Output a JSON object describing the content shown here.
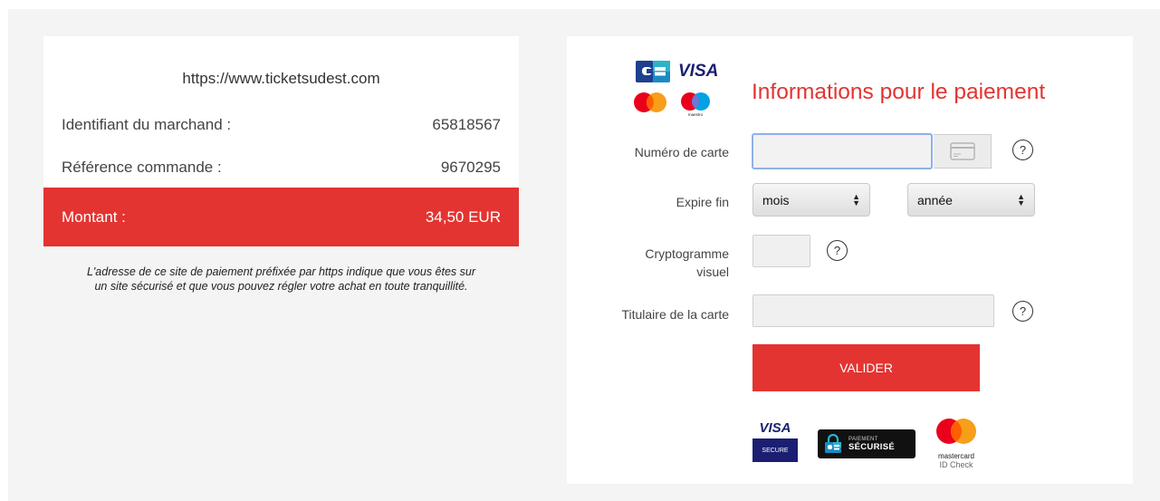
{
  "summary": {
    "site_url": "https://www.ticketsudest.com",
    "merchant_label": "Identifiant du marchand :",
    "merchant_value": "65818567",
    "reference_label": "Référence commande :",
    "reference_value": "9670295",
    "amount_label": "Montant :",
    "amount_value": "34,50 EUR",
    "notice_line1": "L'adresse de ce site de paiement préfixée par https indique que vous êtes sur",
    "notice_line2": "un site sécurisé et que vous pouvez régler votre achat en toute tranquillité."
  },
  "form": {
    "heading": "Informations pour le paiement",
    "card_number_label": "Numéro de carte",
    "card_number_value": "",
    "expiry_label": "Expire fin",
    "month_selected": "mois",
    "year_selected": "année",
    "cvv_label_line1": "Cryptogramme",
    "cvv_label_line2": "visuel",
    "cvv_value": "",
    "holder_label": "Titulaire de la carte",
    "holder_value": "",
    "help_symbol": "?",
    "submit_label": "VALIDER"
  },
  "logos": {
    "top_visa": "VISA",
    "maestro_text": "maestro"
  },
  "badges": {
    "visa_word": "VISA",
    "visa_secure": "SECURE",
    "cb_small": "PAIEMENT",
    "cb_big": "SÉCURISÉ",
    "mc_brand": "mastercard",
    "mc_sub": "ID Check"
  },
  "colors": {
    "accent_red": "#e33431",
    "visa_blue": "#1a1f71",
    "focus_blue": "#8fb1e8",
    "mc_red": "#eb001b",
    "mc_orange": "#f79e1b",
    "maestro_blue": "#00a2e5"
  }
}
